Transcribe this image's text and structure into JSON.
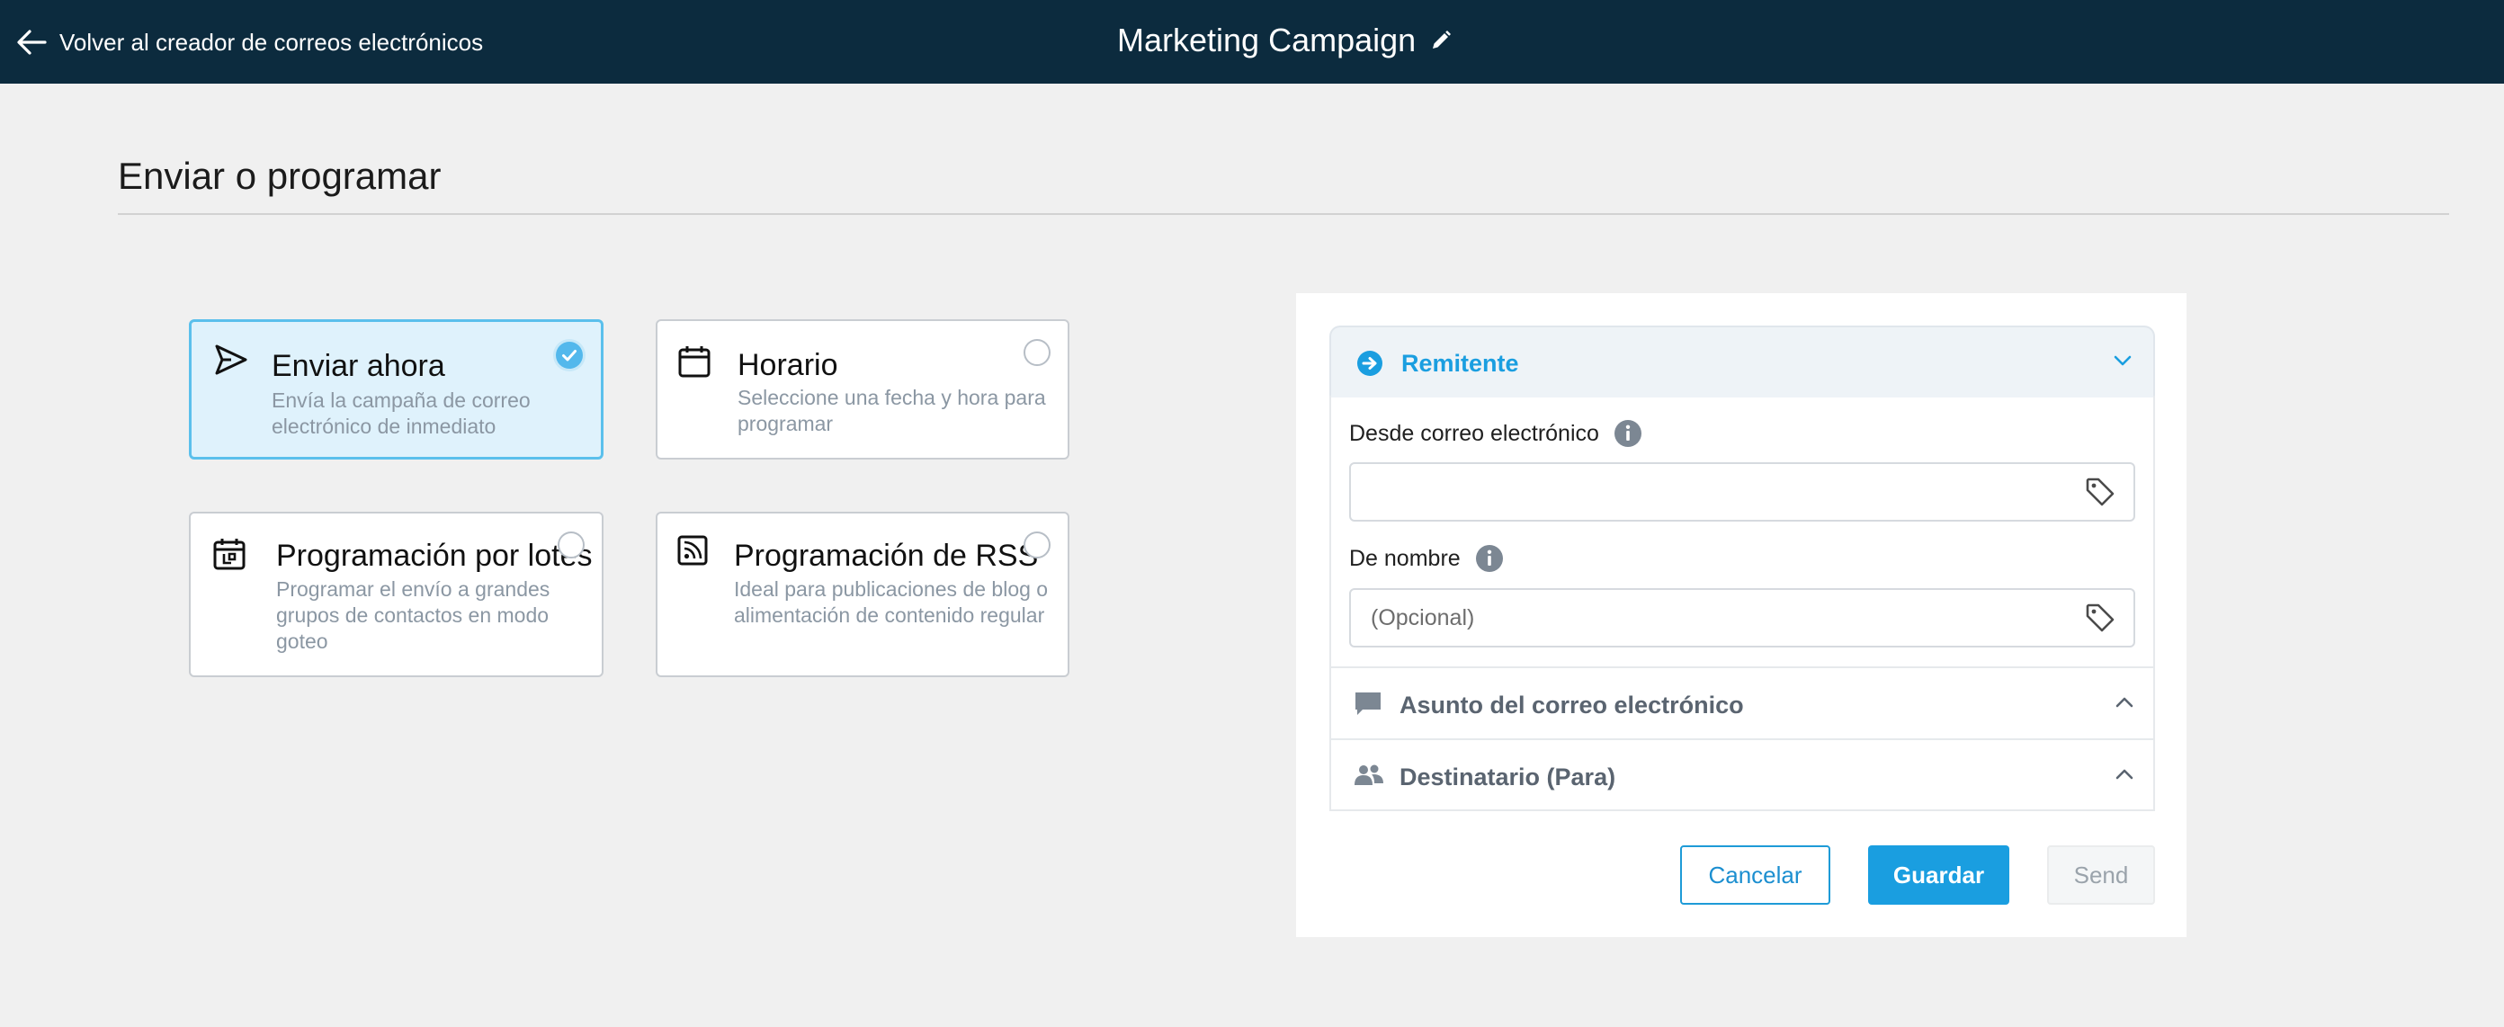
{
  "header": {
    "back_label": "Volver al creador de correos electrónicos",
    "campaign_title": "Marketing Campaign"
  },
  "page": {
    "heading": "Enviar o programar"
  },
  "options": [
    {
      "title": "Enviar ahora",
      "desc": "Envía la campaña de correo electrónico de inmediato",
      "icon": "send-icon",
      "selected": true
    },
    {
      "title": "Horario",
      "desc": "Seleccione una fecha y hora para programar",
      "icon": "calendar-icon",
      "selected": false
    },
    {
      "title": "Programación por lotes",
      "desc": "Programar el envío a grandes grupos de contactos en modo goteo",
      "icon": "batch-calendar-icon",
      "selected": false
    },
    {
      "title": "Programación de RSS",
      "desc": "Ideal para publicaciones de blog o alimentación de contenido regular",
      "icon": "rss-icon",
      "selected": false
    }
  ],
  "panel": {
    "sender": {
      "label": "Remitente",
      "from_email_label": "Desde correo electrónico",
      "from_email_value": "",
      "from_name_label": "De nombre",
      "from_name_placeholder": "(Opcional)"
    },
    "subject": {
      "label": "Asunto del correo electrónico"
    },
    "recipient": {
      "label": "Destinatario (Para)"
    }
  },
  "buttons": {
    "cancel": "Cancelar",
    "save": "Guardar",
    "send": "Send"
  },
  "colors": {
    "header_bg": "#0c2b3e",
    "accent": "#1a9ee0",
    "selected_card_bg": "#dff2fc"
  }
}
